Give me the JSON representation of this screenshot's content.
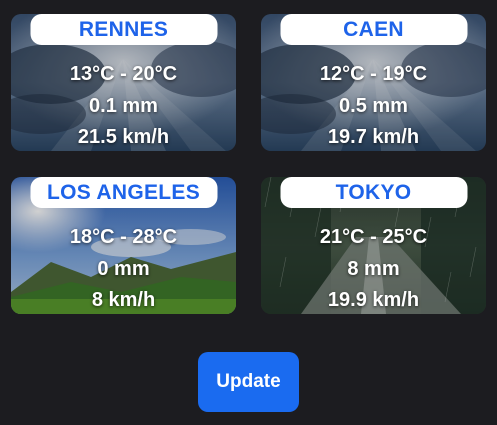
{
  "cards": [
    {
      "city": "RENNES",
      "temp_min": "13°C",
      "temp_max": "20°C",
      "rain": "0.1 mm",
      "wind": "21.5 km/h",
      "background": "cloudy-sunrays-image"
    },
    {
      "city": "CAEN",
      "temp_min": "12°C",
      "temp_max": "19°C",
      "rain": "0.5 mm",
      "wind": "19.7 km/h",
      "background": "cloudy-sunrays-image"
    },
    {
      "city": "LOS ANGELES",
      "temp_min": "18°C",
      "temp_max": "28°C",
      "rain": "0 mm",
      "wind": "8 km/h",
      "background": "sunny-landscape-image"
    },
    {
      "city": "TOKYO",
      "temp_min": "21°C",
      "temp_max": "25°C",
      "rain": "8 mm",
      "wind": "19.9 km/h",
      "background": "rainy-forest-road-image"
    }
  ],
  "temp_separator": "-",
  "update_button": {
    "label": "Update"
  },
  "colors": {
    "page_background": "#1c1c20",
    "city_text": "#1e63e9",
    "button": "#1a6bf0"
  }
}
